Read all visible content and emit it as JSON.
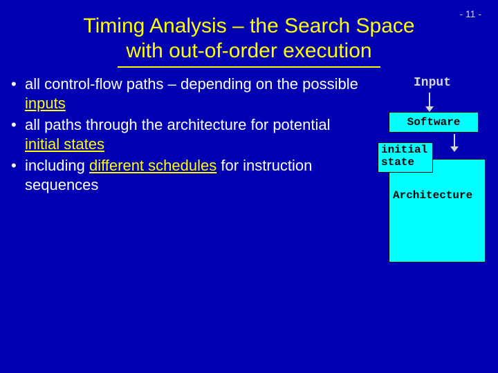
{
  "pageNumber": "- 11 -",
  "title": {
    "line1": "Timing Analysis – the Search Space",
    "line2": "with out-of-order execution"
  },
  "bullets": {
    "b1_pre": "all control-flow paths – depending on the possible ",
    "b1_kw": "inputs",
    "b2_pre": "all paths through the architecture for potential ",
    "b2_kw": "initial states",
    "b3_pre": "including ",
    "b3_kw": "different schedules",
    "b3_post": " for instruction sequences"
  },
  "diagram": {
    "input": "Input",
    "software": "Software",
    "initial_line1": "initial",
    "initial_line2": "state",
    "architecture": "Architecture"
  }
}
